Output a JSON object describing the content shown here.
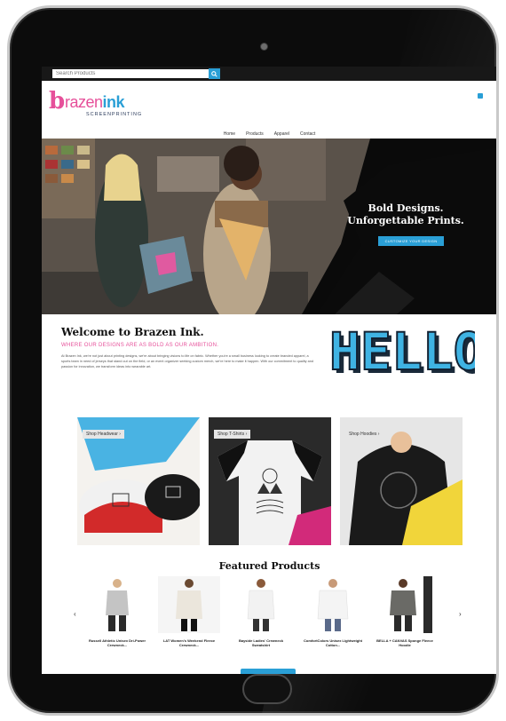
{
  "search": {
    "placeholder": "Search Products"
  },
  "brand": {
    "logo_mark": "b",
    "name_part1": "razen",
    "name_part2": "ink",
    "tagline": "SCREENPRINTING"
  },
  "nav": {
    "items": [
      "Home",
      "Products",
      "Apparel",
      "Contact"
    ]
  },
  "hero": {
    "title": "Bold Designs. Unforgettable Prints.",
    "cta": "CUSTOMIZE YOUR DESIGN"
  },
  "welcome": {
    "title": "Welcome to Brazen Ink.",
    "subtitle": "WHERE OUR DESIGNS ARE AS BOLD AS OUR AMBITION.",
    "body": "At Brazen Ink, we're not just about printing designs, we're about bringing visions to life on fabric. Whether you're a small business looking to create branded apparel, a sports team in need of jerseys that stand out on the field, or an event organizer seeking custom merch, we're here to make it happen. With our commitment to quality and passion for innovation, we transform ideas into wearable art.",
    "hello_text": "HELLO"
  },
  "categories": [
    {
      "label": "Shop Headwear",
      "icon": "chevron-right-icon"
    },
    {
      "label": "Shop T-Shirts",
      "icon": "chevron-right-icon"
    },
    {
      "label": "Shop Hoodies",
      "icon": "chevron-right-icon"
    }
  ],
  "featured": {
    "title": "Featured Products",
    "products": [
      {
        "name": "Russell Athletic Unisex Dri-Power Crewneck..."
      },
      {
        "name": "LAT Women's Weekend Fleece Crewneck..."
      },
      {
        "name": "Bayside Ladies' Crewneck Sweatshirt"
      },
      {
        "name": "ComfortColors Unisex Lightweight Cotton..."
      },
      {
        "name": "BELLA + CANVAS Sponge Fleece Hoodie"
      }
    ]
  },
  "colors": {
    "brand_pink": "#e6509a",
    "brand_blue": "#2a9fd6",
    "topbar": "#181818"
  }
}
